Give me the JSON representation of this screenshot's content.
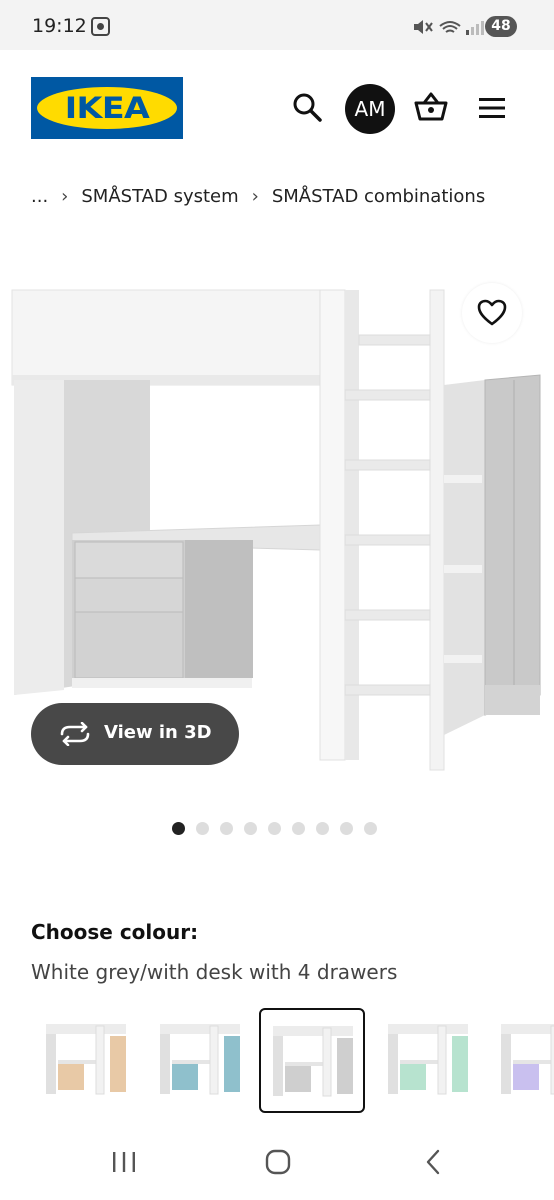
{
  "status_bar": {
    "time": "19:12",
    "battery": "48"
  },
  "header": {
    "logo_text": "IKEA",
    "avatar_initials": "AM",
    "icons": [
      "search-icon",
      "basket-icon",
      "menu-icon"
    ]
  },
  "breadcrumb": {
    "ellipsis": "...",
    "items": [
      "SMÅSTAD system",
      "SMÅSTAD combinations"
    ]
  },
  "product": {
    "view_3d_label": "View in 3D",
    "image_count": 9,
    "active_image": 1
  },
  "colour": {
    "title": "Choose colour:",
    "selected_value": "White grey/with desk with 4 drawers",
    "swatch_colors": [
      "#e8c9a6",
      "#8fc0cc",
      "#cfcfcf",
      "#b7e3cf",
      "#c9c0ef"
    ],
    "selected_index": 2
  },
  "nav": {
    "icons": [
      "recent-apps-icon",
      "home-icon",
      "back-icon"
    ]
  }
}
